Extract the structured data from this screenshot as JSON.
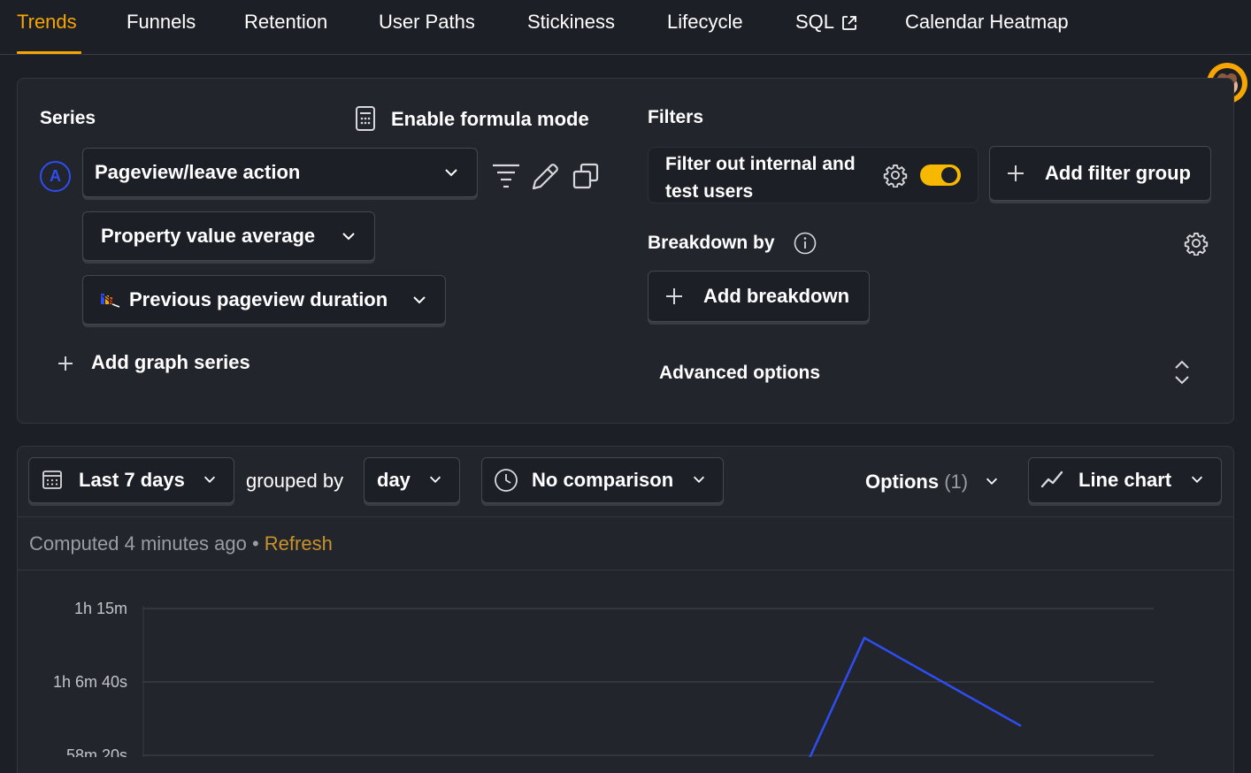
{
  "tabs": [
    {
      "label": "Trends",
      "active": true
    },
    {
      "label": "Funnels"
    },
    {
      "label": "Retention"
    },
    {
      "label": "User Paths"
    },
    {
      "label": "Stickiness"
    },
    {
      "label": "Lifecycle"
    },
    {
      "label": "SQL"
    },
    {
      "label": "Calendar Heatmap"
    }
  ],
  "series": {
    "title": "Series",
    "formula_label": "Enable formula mode",
    "series_letter": "A",
    "event_label": "Pageview/leave action",
    "math_label": "Property value average",
    "property_label": "Previous pageview duration",
    "add_series_label": "Add graph series"
  },
  "filters": {
    "title": "Filters",
    "internal_users_label": "Filter out internal and test users",
    "internal_users_enabled": true,
    "add_filter_group_label": "Add filter group",
    "breakdown_title": "Breakdown by",
    "add_breakdown_label": "Add breakdown",
    "advanced_label": "Advanced options"
  },
  "toolbar": {
    "date_range": "Last 7 days",
    "grouped_by_label": "grouped by",
    "interval": "day",
    "comparison": "No comparison",
    "options_label": "Options",
    "options_count": "(1)",
    "chart_type": "Line chart"
  },
  "status": {
    "computed": "Computed 4 minutes ago",
    "separator": "•",
    "refresh": "Refresh"
  },
  "chart_data": {
    "type": "line",
    "y_tick_labels": [
      "1h 15m",
      "1h 6m 40s",
      "58m 20s"
    ],
    "series_color": "#2e4ef2",
    "series": [
      {
        "values_seconds": [
          3150,
          4300,
          3700
        ]
      }
    ]
  },
  "colors": {
    "accent": "#f7a501",
    "series": "#2e4ef2",
    "toggle_on": "#f7b800"
  }
}
